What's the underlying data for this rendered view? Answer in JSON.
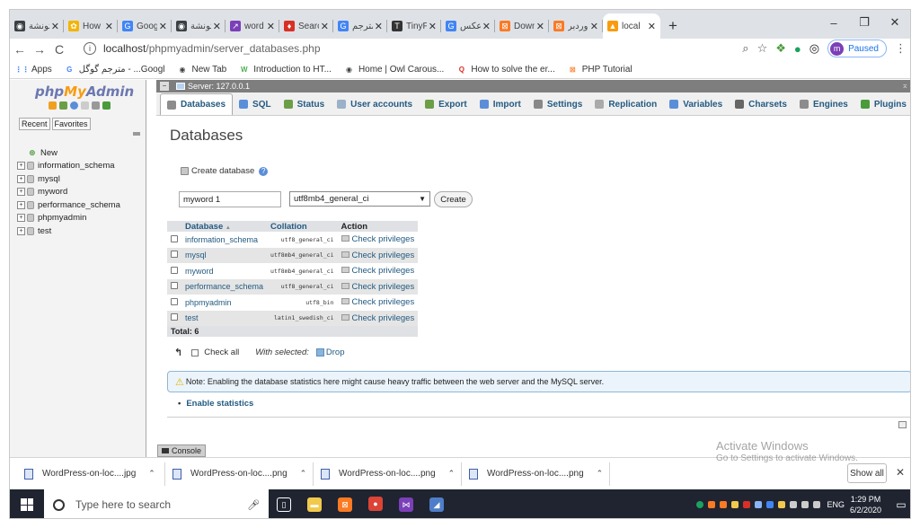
{
  "browser": {
    "tabs": [
      {
        "label": "تونشة",
        "fav_color": "#3c4043",
        "fav": "◉"
      },
      {
        "label": "How t",
        "fav_color": "#f4b400",
        "fav": "✿"
      },
      {
        "label": "Goog",
        "fav_color": "#4285f4",
        "fav": "G"
      },
      {
        "label": "تونشة",
        "fav_color": "#3c4043",
        "fav": "◉"
      },
      {
        "label": "word",
        "fav_color": "#7b3fb8",
        "fav": "↗"
      },
      {
        "label": "Searc",
        "fav_color": "#d93025",
        "fav": "♦"
      },
      {
        "label": "مترجم",
        "fav_color": "#4285f4",
        "fav": "G"
      },
      {
        "label": "TinyP",
        "fav_color": "#333333",
        "fav": "T"
      },
      {
        "label": "عكس",
        "fav_color": "#4285f4",
        "fav": "G"
      },
      {
        "label": "Down",
        "fav_color": "#fb7a24",
        "fav": "⊠"
      },
      {
        "label": "وردبر",
        "fav_color": "#fb7a24",
        "fav": "⊠"
      },
      {
        "label": "local",
        "fav_color": "#f89c0e",
        "fav": "▲",
        "active": true
      }
    ],
    "new_tab_glyph": "+",
    "window_controls": {
      "minimize": "–",
      "restore": "❐",
      "close": "✕"
    },
    "toolbar": {
      "back": "←",
      "forward": "→",
      "reload": "C",
      "url_host": "localhost",
      "url_path": "/phpmyadmin/server_databases.php",
      "info_icon": "i",
      "profile_initial": "m",
      "profile_status": "Paused",
      "menu": "⋮"
    },
    "bookmarks": [
      {
        "label": "Apps",
        "fav_color": "#4285f4",
        "fav": "⋮⋮"
      },
      {
        "label": "مترجم گوگل - ...Googl",
        "fav_color": "#4285f4",
        "fav": "G"
      },
      {
        "label": "New Tab",
        "fav_color": "#3c4043",
        "fav": "◉"
      },
      {
        "label": "Introduction to HT...",
        "fav_color": "#4caf50",
        "fav": "W"
      },
      {
        "label": "Home | Owl Carous...",
        "fav_color": "#3c4043",
        "fav": "◉"
      },
      {
        "label": "How to solve the er...",
        "fav_color": "#d93025",
        "fav": "Q"
      },
      {
        "label": "PHP Tutorial",
        "fav_color": "#fb7a24",
        "fav": "⊠"
      }
    ]
  },
  "pma": {
    "logo_php": "php",
    "logo_my": "My",
    "logo_admin": "Admin",
    "recent": "Recent",
    "favorites": "Favorites",
    "tree": [
      {
        "label": "New",
        "type": "new"
      },
      {
        "label": "information_schema"
      },
      {
        "label": "mysql"
      },
      {
        "label": "myword"
      },
      {
        "label": "performance_schema"
      },
      {
        "label": "phpmyadmin"
      },
      {
        "label": "test"
      }
    ],
    "server_label": "Server: 127.0.0.1",
    "menu": [
      {
        "label": "Databases",
        "color": "#8c8c8c",
        "active": true
      },
      {
        "label": "SQL",
        "color": "#5b8ed8"
      },
      {
        "label": "Status",
        "color": "#6c9e47"
      },
      {
        "label": "User accounts",
        "color": "#9ab1c8"
      },
      {
        "label": "Export",
        "color": "#6c9e47"
      },
      {
        "label": "Import",
        "color": "#5b8ed8"
      },
      {
        "label": "Settings",
        "color": "#888888"
      },
      {
        "label": "Replication",
        "color": "#aaaaaa"
      },
      {
        "label": "Variables",
        "color": "#5b8ed8"
      },
      {
        "label": "Charsets",
        "color": "#666666"
      },
      {
        "label": "Engines",
        "color": "#8c8c8c"
      },
      {
        "label": "Plugins",
        "color": "#4a9b3b"
      }
    ],
    "page_title": "Databases",
    "create_db_label": "Create database",
    "db_name_value": "myword 1",
    "collation_value": "utf8mb4_general_ci",
    "create_button": "Create",
    "table": {
      "headers": {
        "database": "Database",
        "sort_arrow": "▲",
        "collation": "Collation",
        "action": "Action"
      },
      "rows": [
        {
          "name": "information_schema",
          "collation": "utf8_general_ci",
          "action": "Check privileges"
        },
        {
          "name": "mysql",
          "collation": "utf8mb4_general_ci",
          "action": "Check privileges"
        },
        {
          "name": "myword",
          "collation": "utf8mb4_general_ci",
          "action": "Check privileges"
        },
        {
          "name": "performance_schema",
          "collation": "utf8_general_ci",
          "action": "Check privileges"
        },
        {
          "name": "phpmyadmin",
          "collation": "utf8_bin",
          "action": "Check privileges"
        },
        {
          "name": "test",
          "collation": "latin1_swedish_ci",
          "action": "Check privileges"
        }
      ],
      "total": "Total: 6"
    },
    "check_all": "Check all",
    "with_selected": "With selected:",
    "drop": "Drop",
    "notice": "Note: Enabling the database statistics here might cause heavy traffic between the web server and the MySQL server.",
    "enable_stats": "Enable statistics",
    "console": "Console"
  },
  "downloads": {
    "items": [
      {
        "label": "WordPress-on-loc....jpg"
      },
      {
        "label": "WordPress-on-loc....png"
      },
      {
        "label": "WordPress-on-loc....png"
      },
      {
        "label": "WordPress-on-loc....png"
      }
    ],
    "show_all": "Show all",
    "close": "✕"
  },
  "watermark": {
    "title": "Activate Windows",
    "subtitle": "Go to Settings to activate Windows."
  },
  "taskbar": {
    "search_placeholder": "Type here to search",
    "apps": [
      {
        "name": "task-view",
        "color": "#1f2430",
        "glyph": "▯"
      },
      {
        "name": "file-explorer",
        "color": "#f2c94c",
        "glyph": "▬"
      },
      {
        "name": "xampp",
        "color": "#fb7a24",
        "glyph": "⊠"
      },
      {
        "name": "chrome",
        "color": "#db4437",
        "glyph": "●",
        "active": true
      },
      {
        "name": "visual-studio",
        "color": "#7b3fb8",
        "glyph": "⋈"
      },
      {
        "name": "app-blue",
        "color": "#4f7ec9",
        "glyph": "◢"
      }
    ],
    "lang": "ENG",
    "time": "1:29 PM",
    "date": "6/2/2020"
  }
}
